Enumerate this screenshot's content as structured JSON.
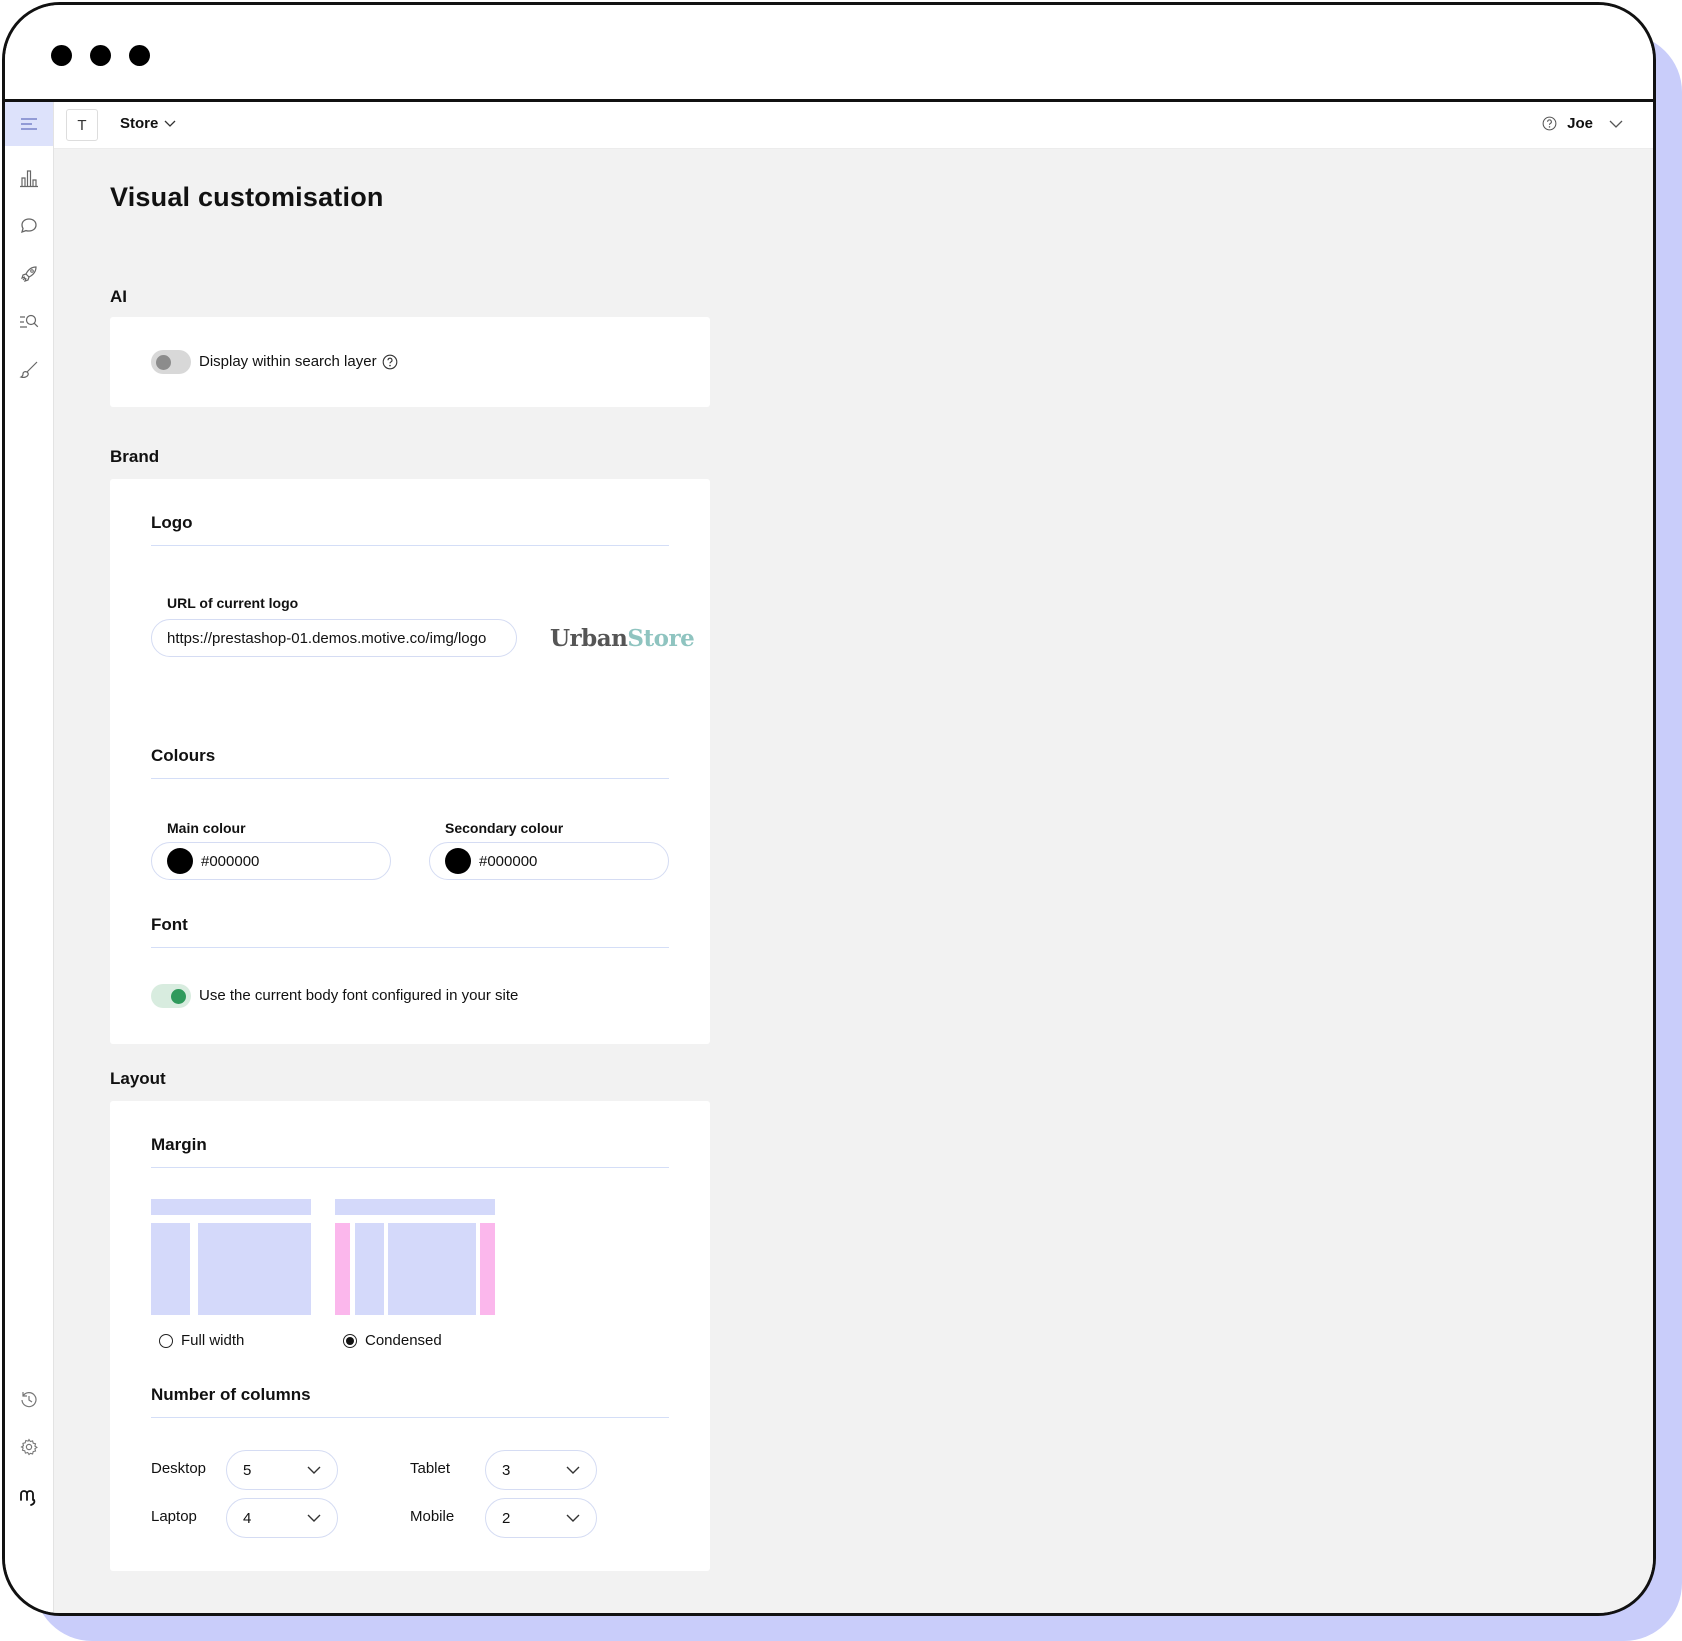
{
  "topbar": {
    "workspace_initial": "T",
    "store_label": "Store",
    "user_name": "Joe"
  },
  "page": {
    "title": "Visual customisation"
  },
  "ai": {
    "section_label": "AI",
    "toggle_label": "Display within search layer",
    "toggle_on": false
  },
  "brand": {
    "section_label": "Brand",
    "logo": {
      "heading": "Logo",
      "url_label": "URL of current logo",
      "url_value": "https://prestashop-01.demos.motive.co/img/logo",
      "preview_part1": "Urban",
      "preview_part2": "Store"
    },
    "colours": {
      "heading": "Colours",
      "main_label": "Main colour",
      "main_value": "#000000",
      "secondary_label": "Secondary colour",
      "secondary_value": "#000000"
    },
    "font": {
      "heading": "Font",
      "toggle_label": "Use the current body font configured in your site",
      "toggle_on": true
    }
  },
  "layout": {
    "section_label": "Layout",
    "margin": {
      "heading": "Margin",
      "options": [
        {
          "label": "Full width",
          "selected": false
        },
        {
          "label": "Condensed",
          "selected": true
        }
      ]
    },
    "columns": {
      "heading": "Number of columns",
      "fields": [
        {
          "label": "Desktop",
          "value": "5"
        },
        {
          "label": "Tablet",
          "value": "3"
        },
        {
          "label": "Laptop",
          "value": "4"
        },
        {
          "label": "Mobile",
          "value": "2"
        }
      ]
    }
  },
  "colors": {
    "accent": "#d4d9fa",
    "shadow": "#c9cdfa",
    "margin_pink": "#fbb7ec",
    "toggle_on_track": "#d8ecdf",
    "toggle_on_knob": "#2f9a5c",
    "toggle_off_track": "#d8d8d8",
    "toggle_off_knob": "#8c8c8c",
    "logo_dark": "#555555",
    "logo_teal": "#8fc4c0"
  },
  "icons": [
    "menu-icon",
    "chart-icon",
    "chat-icon",
    "rocket-icon",
    "search-list-icon",
    "brush-icon",
    "history-icon",
    "gear-icon",
    "brand-logo-icon",
    "help-icon",
    "chevron-down-icon"
  ]
}
